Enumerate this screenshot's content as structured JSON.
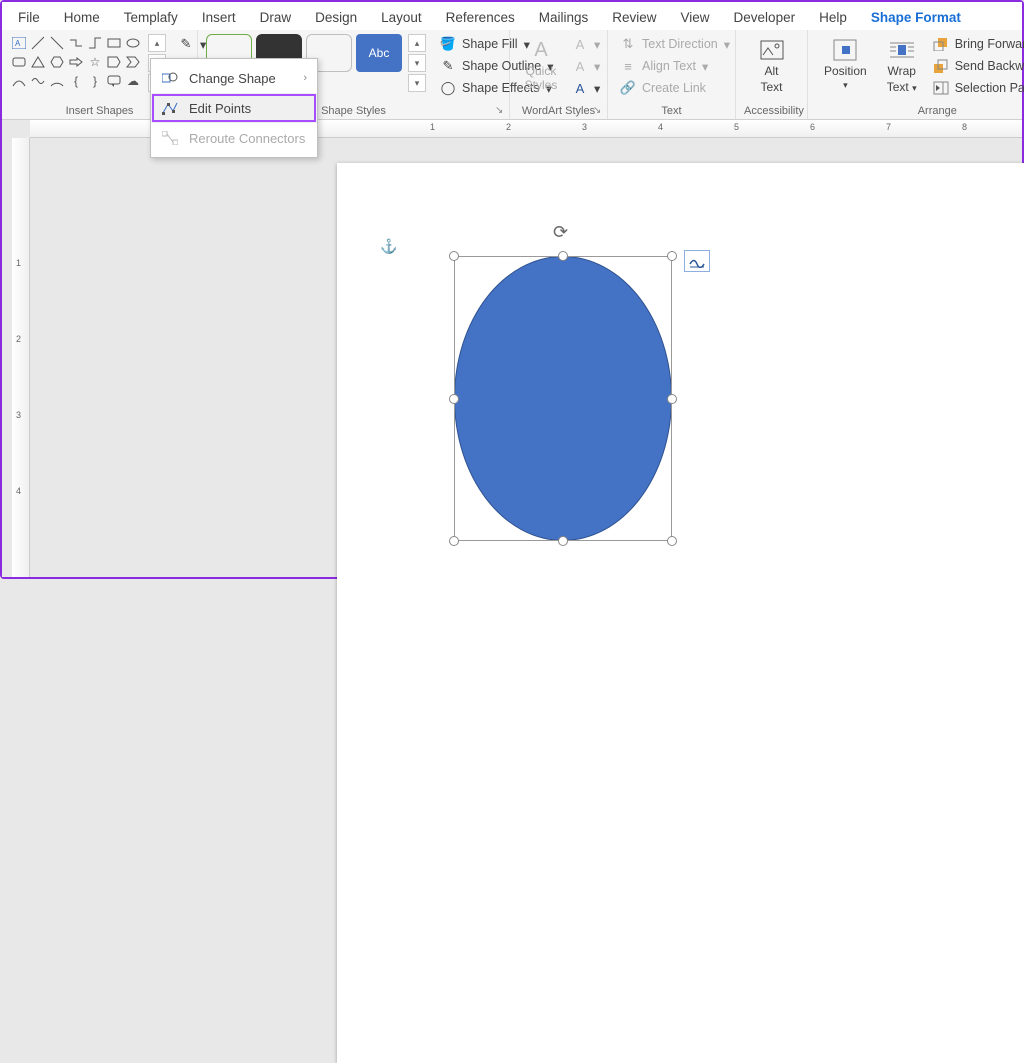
{
  "tabs": [
    "File",
    "Home",
    "Templafy",
    "Insert",
    "Draw",
    "Design",
    "Layout",
    "References",
    "Mailings",
    "Review",
    "View",
    "Developer",
    "Help",
    "Shape Format"
  ],
  "active_tab": "Shape Format",
  "groups": {
    "insert_shapes": "Insert Shapes",
    "shape_styles": "Shape Styles",
    "wordart_styles": "WordArt Styles",
    "text": "Text",
    "accessibility": "Accessibility",
    "arrange": "Arrange"
  },
  "dropdown": {
    "change_shape": "Change Shape",
    "edit_points": "Edit Points",
    "reroute": "Reroute Connectors"
  },
  "shape_options": {
    "fill": "Shape Fill",
    "outline": "Shape Outline",
    "effects": "Shape Effects"
  },
  "sample_label": "Abc",
  "wordart": {
    "quick_styles": "Quick\nStyles"
  },
  "text_group": {
    "direction": "Text Direction",
    "align": "Align Text",
    "link": "Create Link"
  },
  "accessibility": {
    "alt1": "Alt",
    "alt2": "Text"
  },
  "arrange": {
    "position": "Position",
    "wrap1": "Wrap",
    "wrap2": "Text",
    "bring_forward": "Bring Forward",
    "send_backward": "Send Backward",
    "selection_pane": "Selection Pane"
  },
  "shape_color": "#4472c4",
  "ruler_h_labels": [
    "1",
    "2",
    "3",
    "4",
    "5",
    "6",
    "7",
    "8"
  ],
  "ruler_v_labels": [
    "1",
    "2",
    "3",
    "4"
  ]
}
